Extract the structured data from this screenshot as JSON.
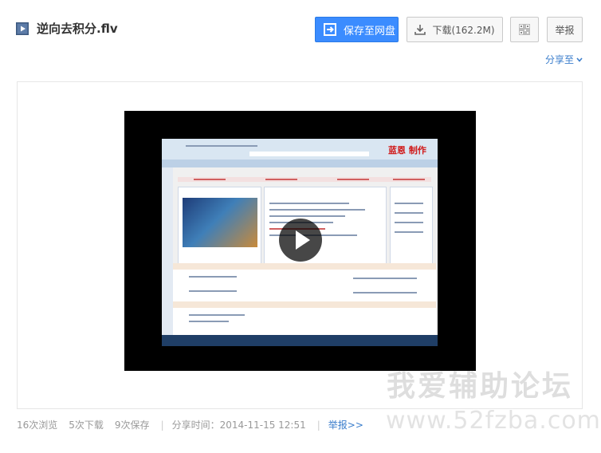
{
  "file": {
    "title": "逆向去积分.flv",
    "icon": "video-file-icon"
  },
  "toolbar": {
    "save_label": "保存至网盘",
    "download_label": "下载(162.2M)",
    "report_label": "举报",
    "qr_icon": "qr-code-icon",
    "share_label": "分享至"
  },
  "player": {
    "play_icon": "play-icon",
    "recording_watermark": "蓝恩 制作"
  },
  "watermark": {
    "line1": "我爱辅助论坛",
    "line2": "www.52fzba.com"
  },
  "stats": {
    "views": "16次浏览",
    "downloads": "5次下载",
    "saves": "9次保存",
    "share_time": "分享时间：2014-11-15 12:51",
    "report_link": "举报>>"
  },
  "colors": {
    "primary": "#3b8cff",
    "link": "#3b7ecc",
    "muted": "#999999"
  }
}
